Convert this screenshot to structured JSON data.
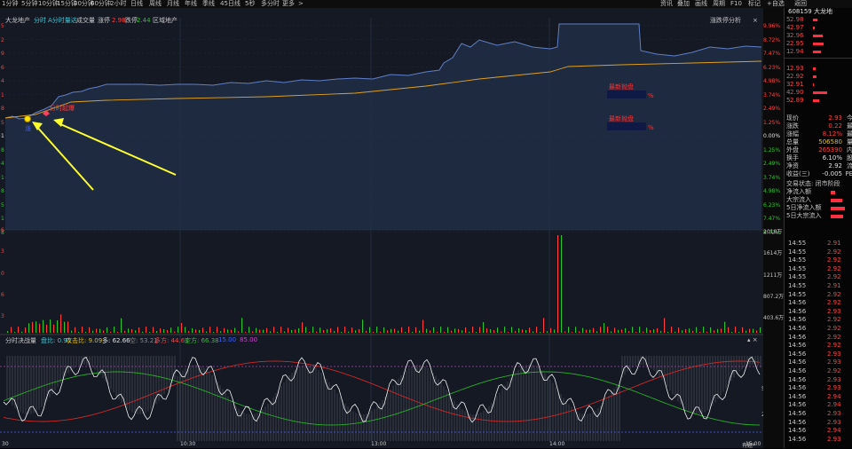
{
  "toolbar": {
    "left_items": [
      "1分钟",
      "5分钟",
      "10分钟",
      "15分钟",
      "30分钟",
      "60分钟",
      "2小时",
      "日线",
      "周线",
      "月线",
      "年线",
      "季线",
      "45日线",
      "5秒",
      "多分时",
      "更多"
    ],
    "more_arrow": ">",
    "right_items": [
      "资讯",
      "叠加",
      "画线",
      "周期",
      "F10",
      "标记",
      "+自选",
      "返回"
    ]
  },
  "infobar": {
    "stock_name": "大龙地产",
    "items": [
      {
        "text": "分时",
        "color": "#40c8d8"
      },
      {
        "text": "A分时量达",
        "color": "#40c8d8"
      },
      {
        "text": "成交量",
        "color": "#c8c8c8"
      },
      {
        "text": "涨停",
        "color": "#c8c8c8"
      },
      {
        "text": "2.98",
        "color": "#ff4040"
      },
      {
        "text": "跌停",
        "color": "#c8c8c8"
      },
      {
        "text": "2.44",
        "color": "#30c030"
      },
      {
        "text": "区域地产",
        "color": "#c8c8c8"
      }
    ],
    "toolbox": "涨跌停分析",
    "close_icon": "×"
  },
  "price_axis_right": [
    {
      "t": "9.96%",
      "c": "#ff4040"
    },
    {
      "t": "8.72%",
      "c": "#ff4040"
    },
    {
      "t": "7.47%",
      "c": "#ff4040"
    },
    {
      "t": "6.23%",
      "c": "#ff4040"
    },
    {
      "t": "4.98%",
      "c": "#ff4040"
    },
    {
      "t": "3.74%",
      "c": "#ff4040"
    },
    {
      "t": "2.49%",
      "c": "#ff4040"
    },
    {
      "t": "1.25%",
      "c": "#ff4040"
    },
    {
      "t": "0.00%",
      "c": "#e0e0e0"
    },
    {
      "t": "1.25%",
      "c": "#30c030"
    },
    {
      "t": "2.49%",
      "c": "#30c030"
    },
    {
      "t": "3.74%",
      "c": "#30c030"
    },
    {
      "t": "4.98%",
      "c": "#30c030"
    },
    {
      "t": "6.23%",
      "c": "#30c030"
    },
    {
      "t": "7.47%",
      "c": "#30c030"
    },
    {
      "t": "8.72%",
      "c": "#30c030"
    }
  ],
  "price_axis_left": [
    {
      "t": "5",
      "c": "#ff4040"
    },
    {
      "t": "2",
      "c": "#ff4040"
    },
    {
      "t": "9",
      "c": "#ff4040"
    },
    {
      "t": "6",
      "c": "#ff4040"
    },
    {
      "t": "4",
      "c": "#ff4040"
    },
    {
      "t": "1",
      "c": "#ff4040"
    },
    {
      "t": "8",
      "c": "#ff4040"
    },
    {
      "t": "5",
      "c": "#ff4040"
    },
    {
      "t": "1",
      "c": "#e0e0e0"
    },
    {
      "t": "8",
      "c": "#30c030"
    },
    {
      "t": "4",
      "c": "#30c030"
    },
    {
      "t": "1",
      "c": "#30c030"
    },
    {
      "t": "8",
      "c": "#30c030"
    },
    {
      "t": "5",
      "c": "#30c030"
    },
    {
      "t": "1",
      "c": "#30c030"
    },
    {
      "t": "8",
      "c": "#30c030"
    }
  ],
  "volume_axis_right": [
    "2018万",
    "1614万",
    "1211万",
    "807.2万",
    "403.6万"
  ],
  "volume_axis_left": [
    "6",
    "3",
    "0",
    "6",
    "3"
  ],
  "annotations": {
    "start_label": "分时起爆",
    "box1_title": "最新抛盘",
    "box2_title": "最新抛盘",
    "pct_sign": "%",
    "tiny_label": "涨"
  },
  "indicator_bar": {
    "items": [
      {
        "text": "分时决战量",
        "color": "#c8c8c8"
      },
      {
        "text": "盘比: 0.91",
        "color": "#40c8d8"
      },
      {
        "text": "攻击比: 9.09",
        "color": "#e6c200"
      },
      {
        "text": "多: 62.66",
        "color": "#e0e0e0"
      },
      {
        "text": "空: 53.21",
        "color": "#888888"
      },
      {
        "text": "多方: 44.63",
        "color": "#ff4040"
      },
      {
        "text": "空方: 66.38",
        "color": "#30c030"
      },
      {
        "text": "15.00",
        "color": "#4060ff"
      },
      {
        "text": "85.00",
        "color": "#d040d0"
      }
    ],
    "controls": "▴ ×"
  },
  "indicator_axis_right": [
    "51.27",
    "25.63"
  ],
  "time_axis": [
    "30",
    "10:30",
    "13:00",
    "14:00",
    "15:00"
  ],
  "bottom_right_label": "有题*",
  "right_panel": {
    "code_name": "608159 大龙地",
    "ask_levels": [
      {
        "label": "5",
        "price": "2.98",
        "bar": 0.12
      },
      {
        "label": "4",
        "price": "2.97",
        "bar": 0.05
      },
      {
        "label": "3",
        "price": "2.96",
        "bar": 0.28
      },
      {
        "label": "2",
        "price": "2.95",
        "bar": 0.3
      },
      {
        "label": "1",
        "price": "2.94",
        "bar": 0.22
      }
    ],
    "bid_levels": [
      {
        "label": "1",
        "price": "2.93",
        "bar": 0.08
      },
      {
        "label": "2",
        "price": "2.92",
        "bar": 0.1
      },
      {
        "label": "3",
        "price": "2.91",
        "bar": 0.03
      },
      {
        "label": "4",
        "price": "2.90",
        "bar": 0.4
      },
      {
        "label": "5",
        "price": "2.89",
        "bar": 0.18
      }
    ],
    "quote": [
      {
        "k": "现价",
        "v": "2.93",
        "vc": "#ff4040",
        "x": "今"
      },
      {
        "k": "涨跌",
        "v": "0.22",
        "vc": "#ff4040",
        "x": "最"
      },
      {
        "k": "涨幅",
        "v": "8.12%",
        "vc": "#ff4040",
        "x": "最"
      },
      {
        "k": "总量",
        "v": "506580",
        "vc": "#e6c200",
        "x": "量"
      },
      {
        "k": "外盘",
        "v": "265390",
        "vc": "#ff4040",
        "x": "内"
      },
      {
        "k": "换手",
        "v": "6.10%",
        "vc": "#e0e0e0",
        "x": "股"
      },
      {
        "k": "净资",
        "v": "2.92",
        "vc": "#e0e0e0",
        "x": "流"
      },
      {
        "k": "收益(三)",
        "v": "-0.005",
        "vc": "#e0e0e0",
        "x": "PE"
      }
    ],
    "trade_status": "交易状态: 闭市阶段",
    "flows": [
      {
        "k": "净流入额",
        "bar": 0.2
      },
      {
        "k": "大宗流入",
        "bar": 0.5
      },
      {
        "k": "5日净流入额",
        "bar": 0.6
      },
      {
        "k": "5日大宗流入",
        "bar": 0.55
      }
    ],
    "ticks": [
      {
        "t": "14:55",
        "p": "2.91"
      },
      {
        "t": "14:55",
        "p": "2.92"
      },
      {
        "t": "14:55",
        "p": "2.92"
      },
      {
        "t": "14:55",
        "p": "2.92"
      },
      {
        "t": "14:55",
        "p": "2.92"
      },
      {
        "t": "14:55",
        "p": "2.91"
      },
      {
        "t": "14:55",
        "p": "2.92"
      },
      {
        "t": "14:56",
        "p": "2.92"
      },
      {
        "t": "14:56",
        "p": "2.93"
      },
      {
        "t": "14:56",
        "p": "2.92"
      },
      {
        "t": "14:56",
        "p": "2.92"
      },
      {
        "t": "14:56",
        "p": "2.92"
      },
      {
        "t": "14:56",
        "p": "2.92"
      },
      {
        "t": "14:56",
        "p": "2.93"
      },
      {
        "t": "14:56",
        "p": "2.93"
      },
      {
        "t": "14:56",
        "p": "2.92"
      },
      {
        "t": "14:56",
        "p": "2.93"
      },
      {
        "t": "14:56",
        "p": "2.93"
      },
      {
        "t": "14:56",
        "p": "2.94"
      },
      {
        "t": "14:56",
        "p": "2.94"
      },
      {
        "t": "14:56",
        "p": "2.93"
      },
      {
        "t": "14:56",
        "p": "2.93"
      },
      {
        "t": "14:56",
        "p": "2.94"
      },
      {
        "t": "14:56",
        "p": "2.93"
      }
    ]
  }
}
